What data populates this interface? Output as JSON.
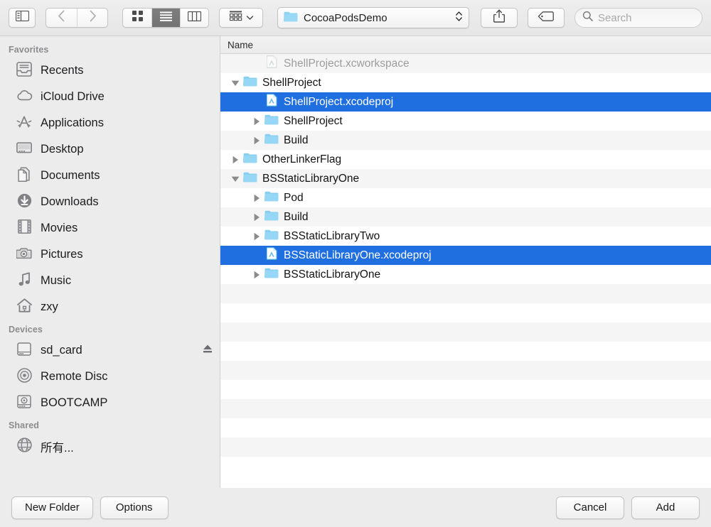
{
  "toolbar": {
    "sidebar_toggle_icon": "sidebar-toggle-icon",
    "back_icon": "chevron-left-icon",
    "forward_icon": "chevron-right-icon",
    "view_icon_grid": "grid-view-icon",
    "view_icon_list": "list-view-icon",
    "view_icon_column": "column-view-icon",
    "arrange_icon": "arrange-grid-icon",
    "arrange_chevron": "chevron-down-icon",
    "path_label": "CocoaPodsDemo",
    "path_folder_icon": "folder-icon",
    "path_chevron_icon": "up-down-chevron-icon",
    "share_icon": "share-icon",
    "tag_icon": "tag-icon",
    "search_icon": "search-icon",
    "search_placeholder": "Search",
    "search_value": ""
  },
  "sidebar": {
    "sections": [
      {
        "header": "Favorites",
        "items": [
          {
            "label": "Recents",
            "icon": "recents-icon"
          },
          {
            "label": "iCloud Drive",
            "icon": "cloud-icon"
          },
          {
            "label": "Applications",
            "icon": "applications-icon"
          },
          {
            "label": "Desktop",
            "icon": "desktop-icon"
          },
          {
            "label": "Documents",
            "icon": "documents-icon"
          },
          {
            "label": "Downloads",
            "icon": "downloads-icon"
          },
          {
            "label": "Movies",
            "icon": "movies-icon"
          },
          {
            "label": "Pictures",
            "icon": "pictures-icon"
          },
          {
            "label": "Music",
            "icon": "music-icon"
          },
          {
            "label": "zxy",
            "icon": "home-icon"
          }
        ]
      },
      {
        "header": "Devices",
        "items": [
          {
            "label": "sd_card",
            "icon": "harddisk-icon",
            "eject": true
          },
          {
            "label": "Remote Disc",
            "icon": "optical-disc-icon"
          },
          {
            "label": "BOOTCAMP",
            "icon": "bootcamp-disk-icon"
          }
        ]
      },
      {
        "header": "Shared",
        "items": [
          {
            "label": "所有...",
            "icon": "network-globe-icon"
          }
        ]
      }
    ],
    "eject_icon": "eject-icon"
  },
  "file_list": {
    "column_header": "Name",
    "rows": [
      {
        "name": "ShellProject.xcworkspace",
        "indent": 1,
        "icon": "xcode-file-icon",
        "twisty": "none",
        "state": "disabled"
      },
      {
        "name": "ShellProject",
        "indent": 0,
        "icon": "folder-icon",
        "twisty": "expanded",
        "state": "normal"
      },
      {
        "name": "ShellProject.xcodeproj",
        "indent": 1,
        "icon": "xcode-file-icon",
        "twisty": "none",
        "state": "selected"
      },
      {
        "name": "ShellProject",
        "indent": 1,
        "icon": "folder-icon",
        "twisty": "collapsed",
        "state": "normal"
      },
      {
        "name": "Build",
        "indent": 1,
        "icon": "folder-icon",
        "twisty": "collapsed",
        "state": "normal"
      },
      {
        "name": "OtherLinkerFlag",
        "indent": 0,
        "icon": "folder-icon",
        "twisty": "collapsed",
        "state": "normal"
      },
      {
        "name": "BSStaticLibraryOne",
        "indent": 0,
        "icon": "folder-icon",
        "twisty": "expanded",
        "state": "normal"
      },
      {
        "name": "Pod",
        "indent": 1,
        "icon": "folder-icon",
        "twisty": "collapsed",
        "state": "normal"
      },
      {
        "name": "Build",
        "indent": 1,
        "icon": "folder-icon",
        "twisty": "collapsed",
        "state": "normal"
      },
      {
        "name": "BSStaticLibraryTwo",
        "indent": 1,
        "icon": "folder-icon",
        "twisty": "collapsed",
        "state": "normal"
      },
      {
        "name": "BSStaticLibraryOne.xcodeproj",
        "indent": 1,
        "icon": "xcode-file-icon",
        "twisty": "none",
        "state": "selected"
      },
      {
        "name": "BSStaticLibraryOne",
        "indent": 1,
        "icon": "folder-icon",
        "twisty": "collapsed",
        "state": "normal"
      }
    ],
    "empty_row_count": 10
  },
  "footer": {
    "new_folder_label": "New Folder",
    "options_label": "Options",
    "cancel_label": "Cancel",
    "add_label": "Add"
  },
  "colors": {
    "selection_blue": "#1f6fe0",
    "folder_blue": "#8cd2f2",
    "window_chrome": "#ececec",
    "sidebar_bg": "#ececed",
    "row_stripe": "#f5f5f5"
  }
}
